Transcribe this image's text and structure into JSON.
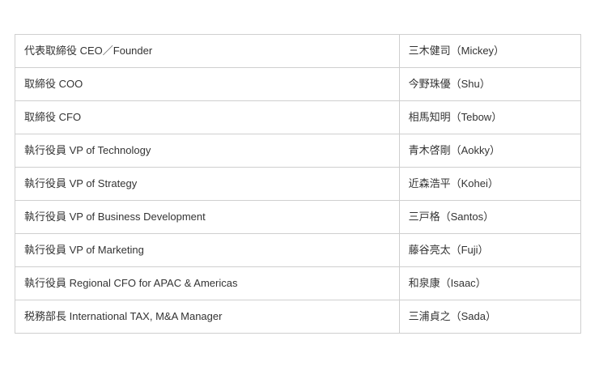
{
  "officers": [
    {
      "role": "代表取締役 CEO／Founder",
      "name": "三木健司（Mickey）"
    },
    {
      "role": "取締役 COO",
      "name": "今野珠優（Shu）"
    },
    {
      "role": "取締役 CFO",
      "name": "相馬知明（Tebow）"
    },
    {
      "role": "執行役員 VP of Technology",
      "name": "青木啓剛（Aokky）"
    },
    {
      "role": "執行役員 VP of Strategy",
      "name": "近森浩平（Kohei）"
    },
    {
      "role": "執行役員 VP of Business Development",
      "name": "三戸格（Santos）"
    },
    {
      "role": "執行役員 VP of Marketing",
      "name": "藤谷亮太（Fuji）"
    },
    {
      "role": "執行役員 Regional CFO for APAC & Americas",
      "name": "和泉康（Isaac）"
    },
    {
      "role": "税務部長 International TAX, M&A Manager",
      "name": "三浦貞之（Sada）"
    }
  ]
}
